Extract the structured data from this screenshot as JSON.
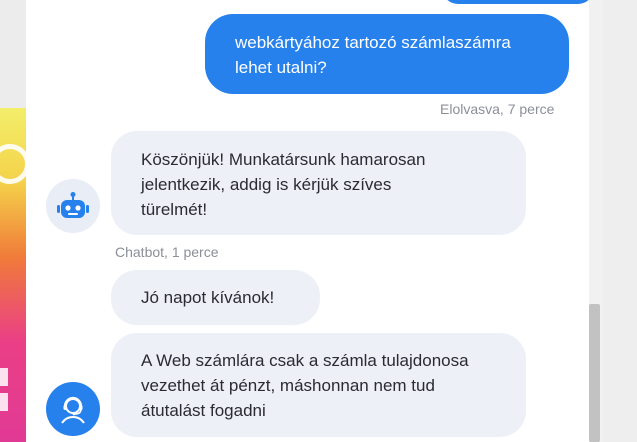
{
  "messages": {
    "user_1": {
      "line1": "webkártyához tartozó számlaszámra",
      "line2": "lehet utalni?"
    },
    "user_1_status": "Elolvasva, 7 perce",
    "bot_1": {
      "line1": "Köszönjük! Munkatársunk hamarosan",
      "line2": "jelentkezik, addig is kérjük szíves",
      "line3": "türelmét!"
    },
    "bot_1_meta": "Chatbot, 1 perce",
    "agent_1": "Jó napot kívánok!",
    "agent_2": {
      "line1": "A Web számlára csak a számla tulajdonosa",
      "line2": "vezethet át pénzt, máshonnan nem tud",
      "line3": "átutalást fogadni"
    }
  },
  "colors": {
    "user_bubble": "#2681ec",
    "bot_bubble": "#eef0f7",
    "meta_text": "#8b8f98"
  },
  "icons": {
    "bot_avatar": "robot-icon",
    "agent_avatar": "support-agent-icon"
  }
}
